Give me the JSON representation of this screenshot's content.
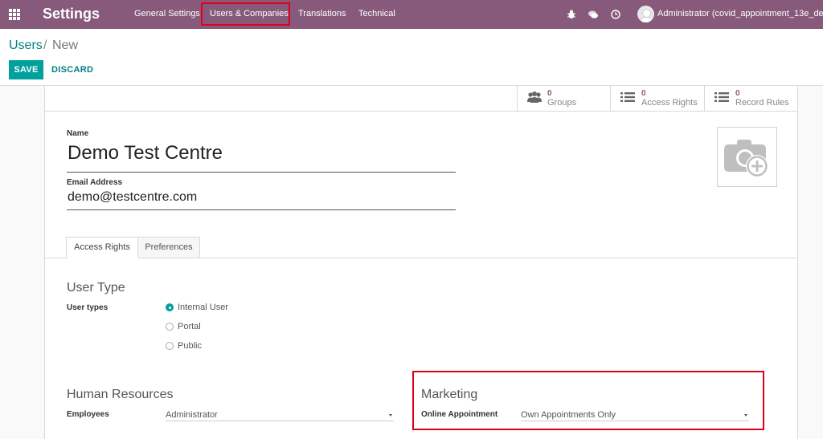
{
  "navbar": {
    "brand": "Settings",
    "menu": [
      "General Settings",
      "Users & Companies",
      "Translations",
      "Technical"
    ],
    "user": "Administrator (covid_appointment_13e_dem",
    "accent": "#875a7b"
  },
  "breadcrumb": {
    "parent": "Users",
    "separator": "/",
    "current": "New"
  },
  "actions": {
    "save": "SAVE",
    "discard": "DISCARD"
  },
  "smart_buttons": [
    {
      "count": "0",
      "label": "Groups",
      "icon": "users-icon"
    },
    {
      "count": "0",
      "label": "Access Rights",
      "icon": "list-icon"
    },
    {
      "count": "0",
      "label": "Record Rules",
      "icon": "list-icon"
    }
  ],
  "form": {
    "name_label": "Name",
    "name_value": "Demo Test Centre",
    "email_label": "Email Address",
    "email_value": "demo@testcentre.com"
  },
  "tabs": [
    "Access Rights",
    "Preferences"
  ],
  "user_type": {
    "title": "User Type",
    "field_label": "User types",
    "options": [
      "Internal User",
      "Portal",
      "Public"
    ],
    "selected": "Internal User"
  },
  "human_resources": {
    "title": "Human Resources",
    "field_label": "Employees",
    "value": "Administrator"
  },
  "marketing": {
    "title": "Marketing",
    "field_label": "Online Appointment",
    "value": "Own Appointments Only"
  },
  "colors": {
    "primary": "#00a09d",
    "highlight": "#e0001b"
  }
}
